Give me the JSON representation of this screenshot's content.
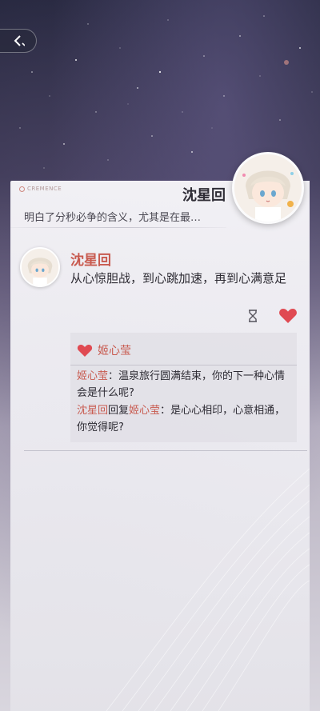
{
  "brand": {
    "text": "CREMENCE"
  },
  "header": {
    "name": "沈星回",
    "subtitle": "明白了分秒必争的含义，尤其是在最…"
  },
  "post": {
    "author": "沈星回",
    "text": "从心惊胆战，到心跳加速，再到心满意足"
  },
  "likes": {
    "names": "姬心莹"
  },
  "comments": [
    {
      "author": "姬心莹",
      "sep": "：",
      "text": "温泉旅行圆满结束，你的下一种心情会是什么呢?"
    },
    {
      "author": "沈星回",
      "reply_word": "回复",
      "reply_to": "姬心莹",
      "sep": "：",
      "text": "是心心相印，心意相通，你觉得呢?"
    }
  ],
  "colors": {
    "accent": "#c85a4f",
    "heart": "#e04a52"
  },
  "icons": [
    "back-icon",
    "hourglass-icon",
    "heart-icon"
  ]
}
